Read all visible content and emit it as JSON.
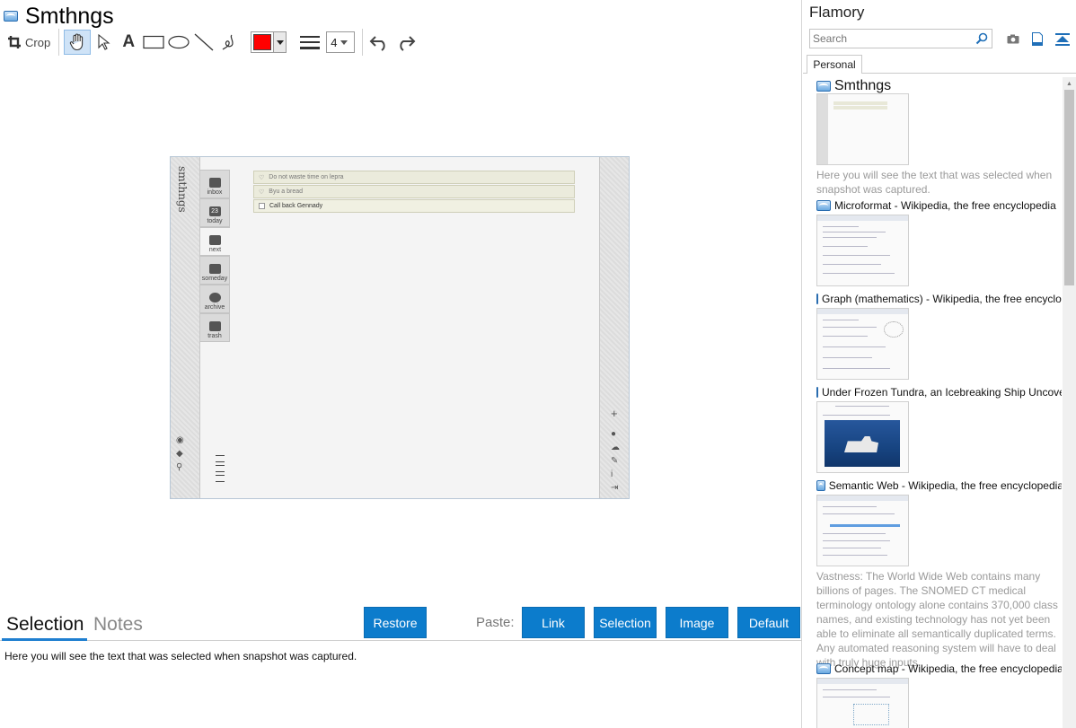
{
  "snapshot": {
    "title": "Smthngs",
    "icon": "snapshot-page-icon"
  },
  "toolbar": {
    "crop_label": "Crop",
    "tools": [
      "crop-icon",
      "hand-icon",
      "pointer-icon",
      "text-icon",
      "rectangle-icon",
      "ellipse-icon",
      "line-icon",
      "freehand-icon",
      "line-width-icon",
      "undo-icon",
      "redo-icon"
    ],
    "text_tool_glyph": "A",
    "selected_tool": "hand",
    "color": "#ff0000",
    "line_width": "4"
  },
  "preview": {
    "app_logo": "smthngs",
    "nav": [
      {
        "label": "inbox",
        "icon": "inbox-icon"
      },
      {
        "label": "today",
        "icon": "calendar-icon",
        "badge": "23"
      },
      {
        "label": "next",
        "icon": "next-icon"
      },
      {
        "label": "someday",
        "icon": "box-icon"
      },
      {
        "label": "archive",
        "icon": "history-icon"
      },
      {
        "label": "trash",
        "icon": "trash-icon"
      }
    ],
    "tasks": [
      {
        "text": "Do not waste time on lepra",
        "done": true
      },
      {
        "text": "Byu a bread",
        "done": true
      },
      {
        "text": "Call back Gennady",
        "done": false
      }
    ],
    "left_tools": [
      "eye-icon",
      "tag-icon",
      "search-icon",
      "settings-icon"
    ],
    "right_tools": [
      "plus-icon",
      "check-circle-icon",
      "cloud-icon",
      "wrench-icon",
      "info-icon",
      "export-icon"
    ]
  },
  "tabs": {
    "selection": "Selection",
    "notes": "Notes",
    "active": "selection"
  },
  "actions": {
    "restore": "Restore",
    "paste_label": "Paste:",
    "link": "Link",
    "selection": "Selection",
    "image": "Image",
    "default": "Default"
  },
  "selection_text": "Here you will see the text that was selected when snapshot was captured.",
  "sidebar": {
    "title": "Flamory",
    "search_placeholder": "Search",
    "icons": [
      "camera-icon",
      "document-icon",
      "collapse-icon"
    ],
    "tab": "Personal",
    "entries": [
      {
        "title": "Smthngs",
        "desc": "Here you will see the text that was selected when snapshot was captured."
      },
      {
        "title": "Microformat - Wikipedia, the free encyclopedia",
        "desc": ""
      },
      {
        "title": "Graph (mathematics) - Wikipedia, the free encyclopedia",
        "desc": ""
      },
      {
        "title": "Under Frozen Tundra, an Icebreaking Ship Uncovers a Mission",
        "desc": ""
      },
      {
        "title": "Semantic Web - Wikipedia, the free encyclopedia",
        "desc": "Vastness: The World Wide Web contains many billions of pages. The SNOMED CT medical terminology ontology alone contains 370,000 class names, and existing technology has not yet been able to eliminate all semantically duplicated terms. Any automated reasoning system will have to deal with truly huge inputs."
      },
      {
        "title": "Concept map - Wikipedia, the free encyclopedia",
        "desc": ""
      }
    ]
  },
  "colors": {
    "accent": "#0c7ccc",
    "selected_tool_bg": "#cfe3f7",
    "muted_text": "#9a9a9a"
  }
}
